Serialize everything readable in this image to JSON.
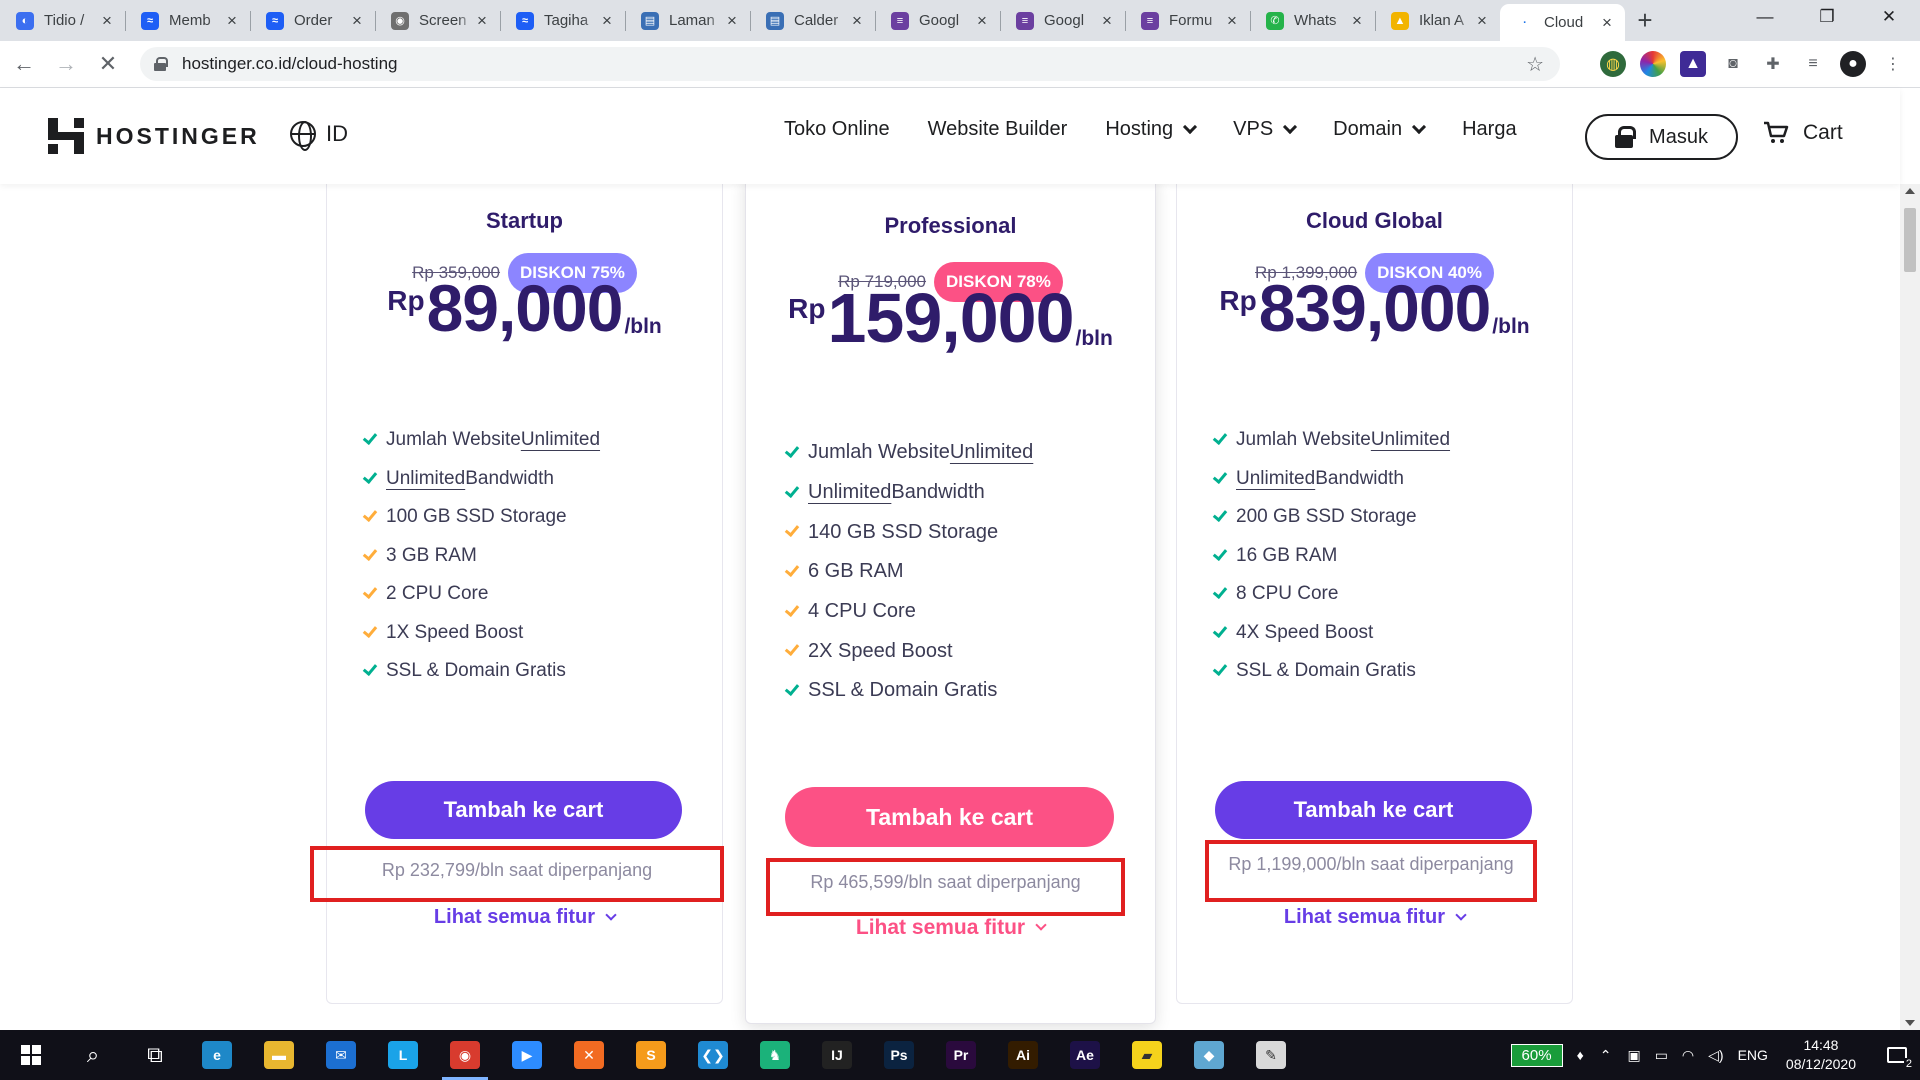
{
  "browser": {
    "tabs": [
      {
        "title": "Tidio /",
        "color": "#3c6ff0",
        "glyph": "◐"
      },
      {
        "title": "Memb",
        "color": "#1e5ef5",
        "glyph": "≈"
      },
      {
        "title": "Order",
        "color": "#1e5ef5",
        "glyph": "≈"
      },
      {
        "title": "Screen",
        "color": "#6f6f6f",
        "glyph": "◉"
      },
      {
        "title": "Tagiha",
        "color": "#1e5ef5",
        "glyph": "≈"
      },
      {
        "title": "Laman",
        "color": "#3a6fb5",
        "glyph": "▤"
      },
      {
        "title": "Calder",
        "color": "#3a6fb5",
        "glyph": "▤"
      },
      {
        "title": "Googl",
        "color": "#6b3fa0",
        "glyph": "≡"
      },
      {
        "title": "Googl",
        "color": "#6b3fa0",
        "glyph": "≡"
      },
      {
        "title": "Formu",
        "color": "#6b3fa0",
        "glyph": "≡"
      },
      {
        "title": "Whats",
        "color": "#25b34a",
        "glyph": "✆"
      },
      {
        "title": "Iklan A",
        "color": "#f2b400",
        "glyph": "▲"
      },
      {
        "title": "Cloud",
        "color": "#1a73e8",
        "glyph": "·",
        "active": true
      }
    ],
    "new_tab": "+",
    "url": "hostinger.co.id/cloud-hosting",
    "window_controls": {
      "minimize": "—",
      "maximize": "❐",
      "close": "✕"
    }
  },
  "site": {
    "brand": "HOSTINGER",
    "lang": "ID",
    "nav": [
      "Toko Online",
      "Website Builder",
      "Hosting",
      "VPS",
      "Domain",
      "Harga"
    ],
    "nav_dropdowns": [
      false,
      false,
      true,
      true,
      true,
      false
    ],
    "login": "Masuk",
    "cart": "Cart"
  },
  "colors": {
    "brand_purple": "#673de6",
    "badge_purple": "#8c85ff",
    "accent_pink": "#fc5185",
    "text_dark": "#2f1c6a",
    "check_green": "#00b090",
    "check_orange": "#ffad3b",
    "highlight_red": "#e02020"
  },
  "plans": [
    {
      "name": "Startup",
      "old_price": "Rp 359,000",
      "discount": "DISKON 75%",
      "currency": "Rp",
      "price": "89,000",
      "period": "/bln",
      "features": [
        {
          "pre": "Jumlah Website ",
          "u": "Unlimited",
          "post": "",
          "check": "green"
        },
        {
          "pre": "",
          "u": "Unlimited",
          "post": " Bandwidth",
          "check": "green"
        },
        {
          "pre": "100 GB SSD Storage",
          "u": "",
          "post": "",
          "check": "orange"
        },
        {
          "pre": "3 GB RAM",
          "u": "",
          "post": "",
          "check": "orange"
        },
        {
          "pre": "2 CPU Core",
          "u": "",
          "post": "",
          "check": "orange"
        },
        {
          "pre": "1X Speed Boost",
          "u": "",
          "post": "",
          "check": "orange"
        },
        {
          "pre": "SSL & Domain Gratis",
          "u": "",
          "post": "",
          "check": "green"
        }
      ],
      "cta": "Tambah ke cart",
      "renewal": "Rp 232,799/bln saat diperpanjang",
      "more": "Lihat semua fitur"
    },
    {
      "name": "Professional",
      "old_price": "Rp 719,000",
      "discount": "DISKON 78%",
      "currency": "Rp",
      "price": "159,000",
      "period": "/bln",
      "features": [
        {
          "pre": "Jumlah Website ",
          "u": "Unlimited",
          "post": "",
          "check": "green"
        },
        {
          "pre": "",
          "u": "Unlimited",
          "post": " Bandwidth",
          "check": "green"
        },
        {
          "pre": "140 GB SSD Storage",
          "u": "",
          "post": "",
          "check": "orange"
        },
        {
          "pre": "6 GB RAM",
          "u": "",
          "post": "",
          "check": "orange"
        },
        {
          "pre": "4 CPU Core",
          "u": "",
          "post": "",
          "check": "orange"
        },
        {
          "pre": "2X Speed Boost",
          "u": "",
          "post": "",
          "check": "orange"
        },
        {
          "pre": "SSL & Domain Gratis",
          "u": "",
          "post": "",
          "check": "green"
        }
      ],
      "cta": "Tambah ke cart",
      "renewal": "Rp 465,599/bln saat diperpanjang",
      "more": "Lihat semua fitur"
    },
    {
      "name": "Cloud Global",
      "old_price": "Rp 1,399,000",
      "discount": "DISKON 40%",
      "currency": "Rp",
      "price": "839,000",
      "period": "/bln",
      "features": [
        {
          "pre": "Jumlah Website ",
          "u": "Unlimited",
          "post": "",
          "check": "green"
        },
        {
          "pre": "",
          "u": "Unlimited",
          "post": " Bandwidth",
          "check": "green"
        },
        {
          "pre": "200 GB SSD Storage",
          "u": "",
          "post": "",
          "check": "green"
        },
        {
          "pre": "16 GB RAM",
          "u": "",
          "post": "",
          "check": "green"
        },
        {
          "pre": "8 CPU Core",
          "u": "",
          "post": "",
          "check": "green"
        },
        {
          "pre": "4X Speed Boost",
          "u": "",
          "post": "",
          "check": "green"
        },
        {
          "pre": "SSL & Domain Gratis",
          "u": "",
          "post": "",
          "check": "green"
        }
      ],
      "cta": "Tambah ke cart",
      "renewal": "Rp 1,199,000/bln saat diperpanjang",
      "more": "Lihat semua fitur"
    }
  ],
  "taskbar": {
    "apps": [
      {
        "name": "search",
        "glyph": "⌕",
        "bg": "transparent"
      },
      {
        "name": "task-view",
        "glyph": "⧉",
        "bg": "transparent"
      },
      {
        "name": "edge",
        "glyph": "e",
        "bg": "#1e88c8"
      },
      {
        "name": "file-explorer",
        "glyph": "▬",
        "bg": "#e8b730"
      },
      {
        "name": "mail",
        "glyph": "✉",
        "bg": "#1c6fd1"
      },
      {
        "name": "launcher-l",
        "glyph": "L",
        "bg": "#1aa3e8"
      },
      {
        "name": "chrome",
        "glyph": "◉",
        "bg": "#d83b2e",
        "active": true
      },
      {
        "name": "zoom",
        "glyph": "▶",
        "bg": "#2d8cff"
      },
      {
        "name": "xampp",
        "glyph": "✕",
        "bg": "#f26b22"
      },
      {
        "name": "sublime",
        "glyph": "S",
        "bg": "#f59b1b"
      },
      {
        "name": "vscode",
        "glyph": "❮❯",
        "bg": "#1f8ad2"
      },
      {
        "name": "gitkraken",
        "glyph": "♞",
        "bg": "#1bb27a"
      },
      {
        "name": "jetbrains",
        "glyph": "IJ",
        "bg": "#222"
      },
      {
        "name": "photoshop",
        "glyph": "Ps",
        "bg": "#0b2340"
      },
      {
        "name": "premiere",
        "glyph": "Pr",
        "bg": "#2a0a3d"
      },
      {
        "name": "illustrator",
        "glyph": "Ai",
        "bg": "#331c00"
      },
      {
        "name": "after-effects",
        "glyph": "Ae",
        "bg": "#1d1147"
      },
      {
        "name": "sticky-notes",
        "glyph": "▰",
        "bg": "#f5d31c"
      },
      {
        "name": "notepad",
        "glyph": "◆",
        "bg": "#5fa7d1"
      },
      {
        "name": "paint",
        "glyph": "✎",
        "bg": "#d9d9d9"
      }
    ],
    "battery": "60%",
    "lang": "ENG",
    "time": "14:48",
    "date": "08/12/2020",
    "notifications": "2"
  }
}
